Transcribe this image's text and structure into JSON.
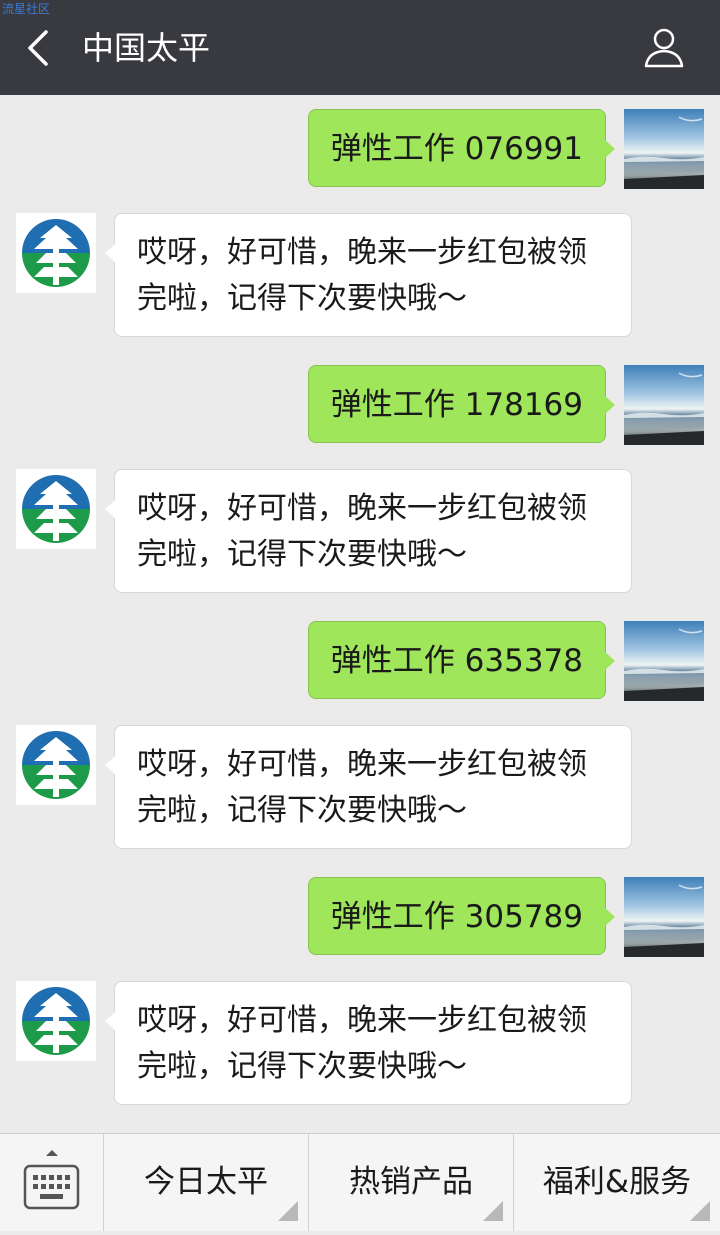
{
  "watermark": "流星社区",
  "header": {
    "title": "中国太平"
  },
  "chat": [
    {
      "outgoing": "弹性工作 076991",
      "reply_line1": "哎呀，好可惜，晚来一步红包被领",
      "reply_line2": "完啦，记得下次要快哦～"
    },
    {
      "outgoing": "弹性工作 178169",
      "reply_line1": "哎呀，好可惜，晚来一步红包被领",
      "reply_line2": "完啦，记得下次要快哦～"
    },
    {
      "outgoing": "弹性工作 635378",
      "reply_line1": "哎呀，好可惜，晚来一步红包被领",
      "reply_line2": "完啦，记得下次要快哦～"
    },
    {
      "outgoing": "弹性工作 305789",
      "reply_line1": "哎呀，好可惜，晚来一步红包被领",
      "reply_line2": "完啦，记得下次要快哦～"
    }
  ],
  "bottom_menu": [
    "今日太平",
    "热销产品",
    "福利&服务"
  ],
  "icons": {
    "back": "chevron-left-icon",
    "profile": "person-icon",
    "keyboard": "keyboard-icon",
    "user_avatar": "seascape-avatar",
    "bot_avatar": "taiping-tree-logo"
  },
  "colors": {
    "topbar": "#393a3f",
    "outgoing_bubble": "#9fe65a",
    "incoming_bubble": "#ffffff",
    "background": "#ebebeb"
  }
}
